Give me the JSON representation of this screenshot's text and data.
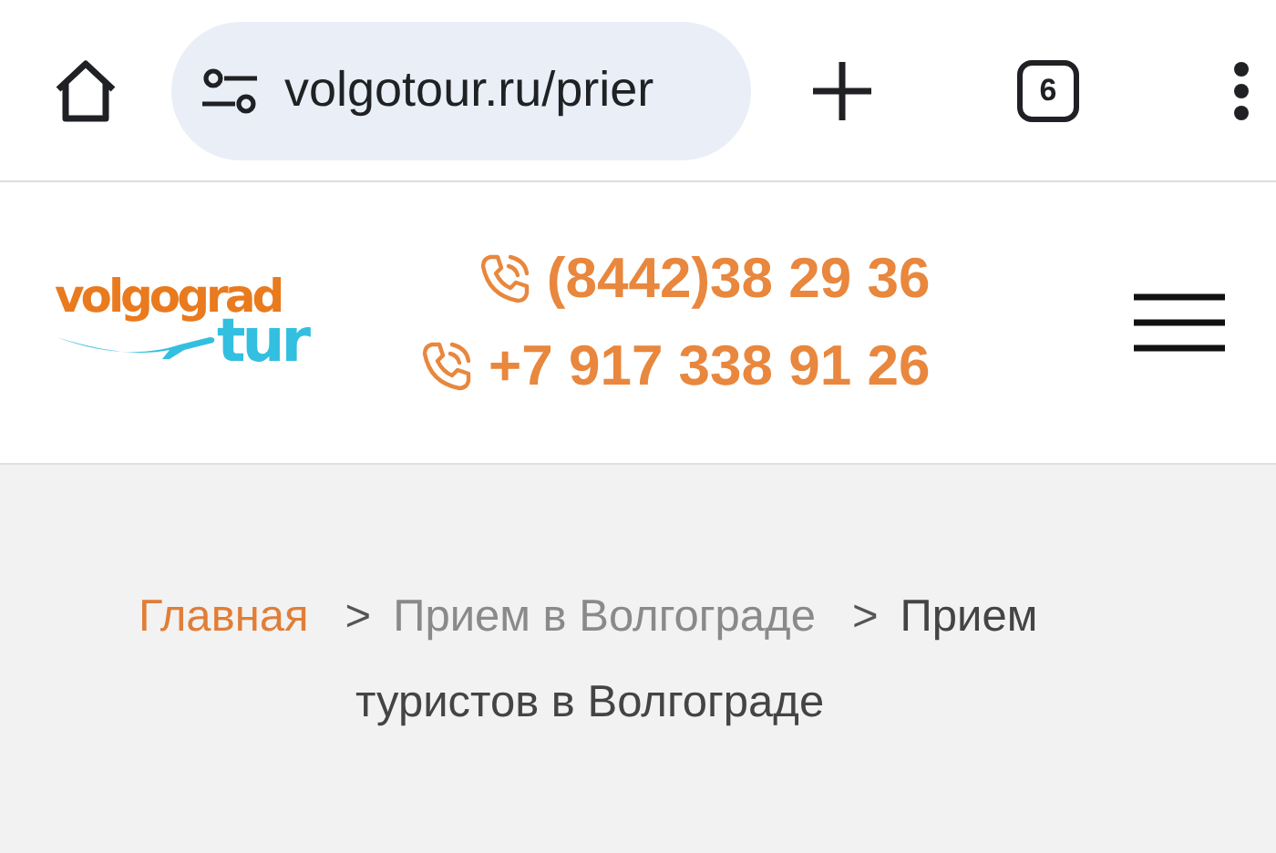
{
  "browser": {
    "url": "volgotour.ru/prier",
    "tab_count": "6"
  },
  "header": {
    "logo": {
      "line_1": "volgograd",
      "line_2": "tur"
    },
    "phones": [
      "(8442)38 29 36",
      "+7 917 338 91 26"
    ]
  },
  "breadcrumb": [
    {
      "text": "Главная",
      "kind": "link"
    },
    {
      "text": ">",
      "kind": "separator"
    },
    {
      "text": "Прием в Волгограде",
      "kind": "parent"
    },
    {
      "text": ">",
      "kind": "separator"
    },
    {
      "text": "Прием туристов в Волгограде",
      "kind": "current"
    }
  ]
}
